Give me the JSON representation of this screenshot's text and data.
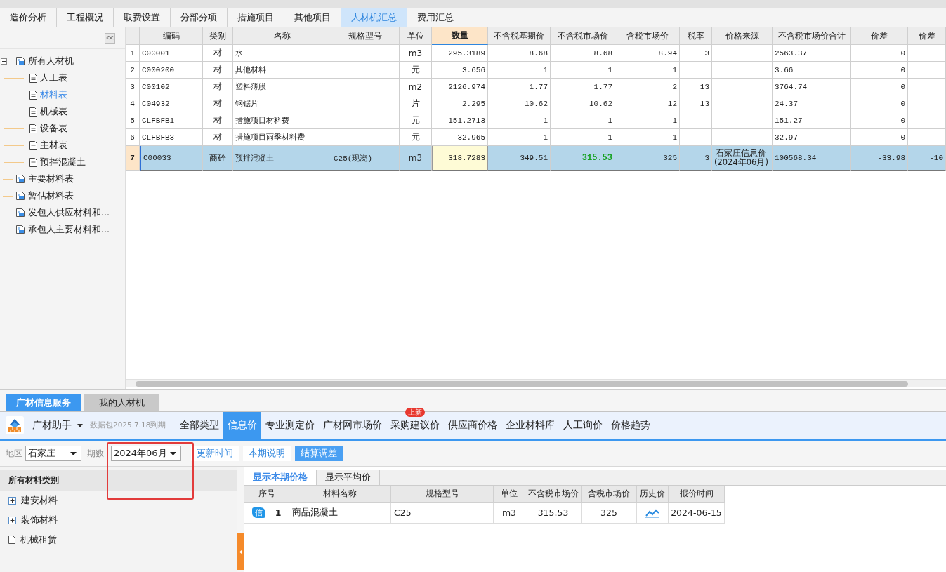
{
  "top_tabs": [
    {
      "label": "造价分析",
      "selected": false
    },
    {
      "label": "工程概况",
      "selected": false
    },
    {
      "label": "取费设置",
      "selected": false
    },
    {
      "label": "分部分项",
      "selected": false
    },
    {
      "label": "措施项目",
      "selected": false
    },
    {
      "label": "其他项目",
      "selected": false
    },
    {
      "label": "人材机汇总",
      "selected": true
    },
    {
      "label": "费用汇总",
      "selected": false
    }
  ],
  "sidebar": {
    "collapse": "<<",
    "tree": [
      {
        "label": "所有人材机",
        "kind": "report",
        "expanded": true,
        "selected": false,
        "children": [
          {
            "label": "人工表",
            "kind": "doc",
            "selected": false
          },
          {
            "label": "材料表",
            "kind": "doc",
            "selected": true
          },
          {
            "label": "机械表",
            "kind": "doc",
            "selected": false
          },
          {
            "label": "设备表",
            "kind": "doc",
            "selected": false
          },
          {
            "label": "主材表",
            "kind": "doc",
            "selected": false
          },
          {
            "label": "预拌混凝土",
            "kind": "doc",
            "selected": false
          }
        ]
      },
      {
        "label": "主要材料表",
        "kind": "report",
        "selected": false
      },
      {
        "label": "暂估材料表",
        "kind": "report",
        "selected": false
      },
      {
        "label": "发包人供应材料和...",
        "kind": "report",
        "selected": false
      },
      {
        "label": "承包人主要材料和...",
        "kind": "report",
        "selected": false
      }
    ]
  },
  "grid": {
    "columns": [
      {
        "label": "编码",
        "active": false
      },
      {
        "label": "类别",
        "active": false
      },
      {
        "label": "名称",
        "active": false
      },
      {
        "label": "规格型号",
        "active": false
      },
      {
        "label": "单位",
        "active": false
      },
      {
        "label": "数量",
        "active": true
      },
      {
        "label": "不含税基期价",
        "active": false
      },
      {
        "label": "不含税市场价",
        "active": false
      },
      {
        "label": "含税市场价",
        "active": false
      },
      {
        "label": "税率",
        "active": false
      },
      {
        "label": "价格来源",
        "active": false
      },
      {
        "label": "不含税市场价合计",
        "active": false
      },
      {
        "label": "价差",
        "active": false
      },
      {
        "label": "价差",
        "active": false
      }
    ],
    "rows": [
      {
        "number": "1",
        "selected": false,
        "cells": [
          "C00001",
          "材",
          "水",
          "",
          "m3",
          "295.3189",
          "8.68",
          "8.68",
          "8.94",
          "3",
          "",
          "2563.37",
          "0",
          ""
        ]
      },
      {
        "number": "2",
        "selected": false,
        "cells": [
          "C000200",
          "材",
          "其他材料",
          "",
          "元",
          "3.656",
          "1",
          "1",
          "1",
          "",
          "",
          "3.66",
          "0",
          ""
        ]
      },
      {
        "number": "3",
        "selected": false,
        "cells": [
          "C00102",
          "材",
          "塑料薄膜",
          "",
          "m2",
          "2126.974",
          "1.77",
          "1.77",
          "2",
          "13",
          "",
          "3764.74",
          "0",
          ""
        ]
      },
      {
        "number": "4",
        "selected": false,
        "cells": [
          "C04932",
          "材",
          "钢锯片",
          "",
          "片",
          "2.295",
          "10.62",
          "10.62",
          "12",
          "13",
          "",
          "24.37",
          "0",
          ""
        ]
      },
      {
        "number": "5",
        "selected": false,
        "cells": [
          "CLFBFB1",
          "材",
          "措施项目材料费",
          "",
          "元",
          "151.2713",
          "1",
          "1",
          "1",
          "",
          "",
          "151.27",
          "0",
          ""
        ]
      },
      {
        "number": "6",
        "selected": false,
        "cells": [
          "CLFBFB3",
          "材",
          "措施项目雨季材料费",
          "",
          "元",
          "32.965",
          "1",
          "1",
          "1",
          "",
          "",
          "32.97",
          "0",
          ""
        ]
      },
      {
        "number": "7",
        "selected": true,
        "cells": [
          "C00033",
          "商砼",
          "预拌混凝土",
          "C25(现浇)",
          "m3",
          "318.7283",
          "349.51",
          {
            "text": "315.53",
            "emphasis": true
          },
          "325",
          "3",
          {
            "text": "石家庄信息价",
            "note": "(2024年06月)"
          },
          "100568.34",
          "-33.98",
          "-10"
        ]
      }
    ]
  },
  "panel_tabs": [
    {
      "label": "广材信息服务",
      "selected": true
    },
    {
      "label": "我的人材机",
      "selected": false
    }
  ],
  "assistant": {
    "name": "广材助手",
    "note": "数据包2025.7.18到期"
  },
  "categories": [
    {
      "label": "全部类型",
      "selected": false
    },
    {
      "label": "信息价",
      "selected": true
    },
    {
      "label": "专业测定价",
      "selected": false
    },
    {
      "label": "广材网市场价",
      "selected": false
    },
    {
      "label": "采购建议价",
      "selected": false,
      "badge": "上新"
    },
    {
      "label": "供应商价格",
      "selected": false
    },
    {
      "label": "企业材料库",
      "selected": false
    },
    {
      "label": "人工询价",
      "selected": false
    },
    {
      "label": "价格趋势",
      "selected": false
    }
  ],
  "filters": {
    "region": {
      "label": "地区",
      "value": "石家庄"
    },
    "period": {
      "label": "期数",
      "value": "2024年06月"
    },
    "buttons": [
      {
        "label": "更新时间",
        "primary": false
      },
      {
        "label": "本期说明",
        "primary": false
      },
      {
        "label": "结算调差",
        "primary": true
      }
    ]
  },
  "category_panel": {
    "title": "所有材料类别",
    "items": [
      {
        "label": "建安材料",
        "kind": "group"
      },
      {
        "label": "装饰材料",
        "kind": "group"
      },
      {
        "label": "机械租赁",
        "kind": "leaf"
      }
    ]
  },
  "price_tabs": [
    {
      "label": "显示本期价格",
      "selected": true
    },
    {
      "label": "显示平均价",
      "selected": false
    }
  ],
  "price_table": {
    "columns": [
      "序号",
      "材料名称",
      "规格型号",
      "单位",
      "不含税市场价",
      "含税市场价",
      "历史价",
      "报价时间"
    ],
    "rows": [
      {
        "badge": "信",
        "cells": [
          "1",
          "商品混凝土",
          "C25",
          "m3",
          "315.53",
          "325",
          "",
          "2024-06-15"
        ],
        "history": true
      }
    ]
  }
}
